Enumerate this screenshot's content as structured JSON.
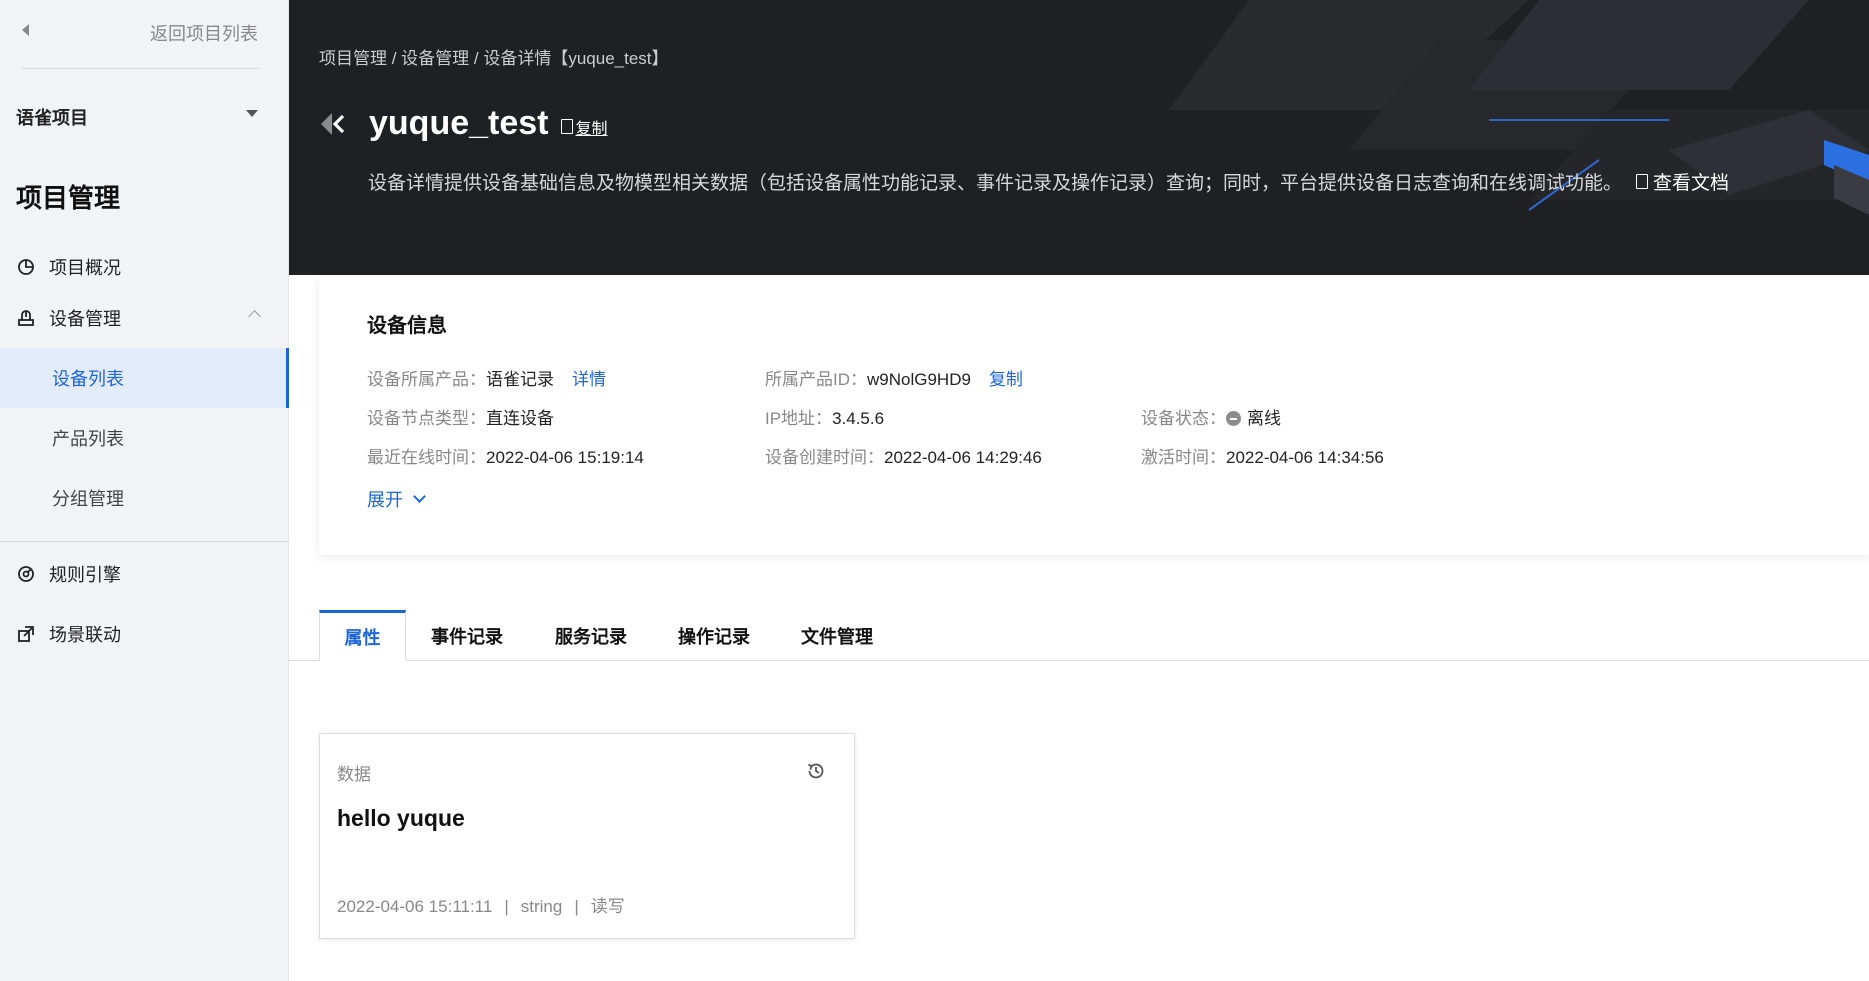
{
  "sidebar": {
    "back_label": "返回项目列表",
    "project_name": "语雀项目",
    "section_title": "项目管理",
    "nav": [
      {
        "label": "项目概况",
        "icon": "pie-chart-icon"
      },
      {
        "label": "设备管理",
        "icon": "device-icon",
        "expanded": true
      },
      {
        "label": "规则引擎",
        "icon": "rule-icon"
      },
      {
        "label": "场景联动",
        "icon": "link-icon"
      }
    ],
    "device_sub": [
      {
        "label": "设备列表",
        "active": true
      },
      {
        "label": "产品列表"
      },
      {
        "label": "分组管理"
      }
    ]
  },
  "header": {
    "breadcrumb": "项目管理 / 设备管理 / 设备详情【yuque_test】",
    "title": "yuque_test",
    "copy_label": "复制",
    "description": "设备详情提供设备基础信息及物模型相关数据（包括设备属性功能记录、事件记录及操作记录）查询；同时，平台提供设备日志查询和在线调试功能。",
    "doc_label": "查看文档"
  },
  "device_info": {
    "title": "设备信息",
    "product_key": "设备所属产品：",
    "product_value": "语雀记录",
    "product_link": "详情",
    "product_id_key": "所属产品ID：",
    "product_id_value": "w9NolG9HD9",
    "product_id_copy": "复制",
    "node_type_key": "设备节点类型：",
    "node_type_value": "直连设备",
    "ip_key": "IP地址：",
    "ip_value": "3.4.5.6",
    "status_key": "设备状态：",
    "status_value": "离线",
    "last_online_key": "最近在线时间：",
    "last_online_value": "2022-04-06 15:19:14",
    "created_key": "设备创建时间：",
    "created_value": "2022-04-06 14:29:46",
    "activated_key": "激活时间：",
    "activated_value": "2022-04-06 14:34:56",
    "expand_label": "展开"
  },
  "tabs": [
    {
      "label": "属性",
      "active": true
    },
    {
      "label": "事件记录"
    },
    {
      "label": "服务记录"
    },
    {
      "label": "操作记录"
    },
    {
      "label": "文件管理"
    }
  ],
  "property_card": {
    "label": "数据",
    "value": "hello yuque",
    "timestamp": "2022-04-06 15:11:11",
    "sep1": "|",
    "type": "string",
    "sep2": "|",
    "access": "读写"
  },
  "colors": {
    "accent": "#1e66d8",
    "header_bg": "#1f2023",
    "sidebar_bg": "#f2f3f5",
    "status_offline": "#8c8c8c"
  }
}
